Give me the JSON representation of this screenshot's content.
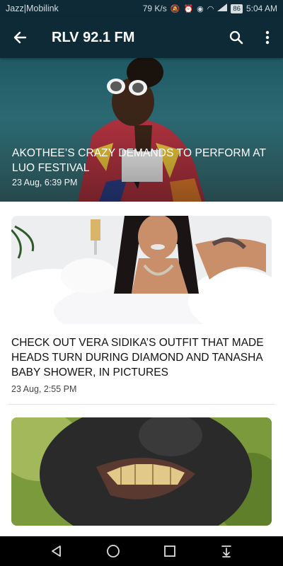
{
  "status_bar": {
    "carrier": "Jazz|Mobilink",
    "speed": "79 K/s",
    "signal_label": "3G",
    "battery": "86",
    "time": "5:04 AM"
  },
  "app_bar": {
    "title": "RLV 92.1 FM",
    "back_icon": "arrow-left",
    "search_icon": "magnifier",
    "menu_icon": "vertical-ellipsis"
  },
  "articles": [
    {
      "title": "AKOTHEE’S CRAZY DEMANDS TO PERFORM AT LUO FESTIVAL",
      "date": "23 Aug, 6:39 PM",
      "image": "woman in sunglasses and patterned jacket"
    },
    {
      "title": "CHECK OUT VERA SIDIKA’S OUTFIT THAT MADE HEADS TURN DURING DIAMOND AND TANASHA BABY SHOWER, IN PICTURES",
      "date": "23 Aug, 2:55 PM",
      "image": "woman in bubble bath with champagne"
    },
    {
      "title": "",
      "date": "",
      "image": "grinning macaque close-up"
    }
  ],
  "nav_bar": {
    "back_icon": "triangle-back",
    "home_icon": "circle-home",
    "recents_icon": "square-recents",
    "notifications_icon": "pull-down"
  },
  "colors": {
    "app_bar": "#0d2a36",
    "nav_bar": "#000000",
    "text_dark": "#111111"
  }
}
